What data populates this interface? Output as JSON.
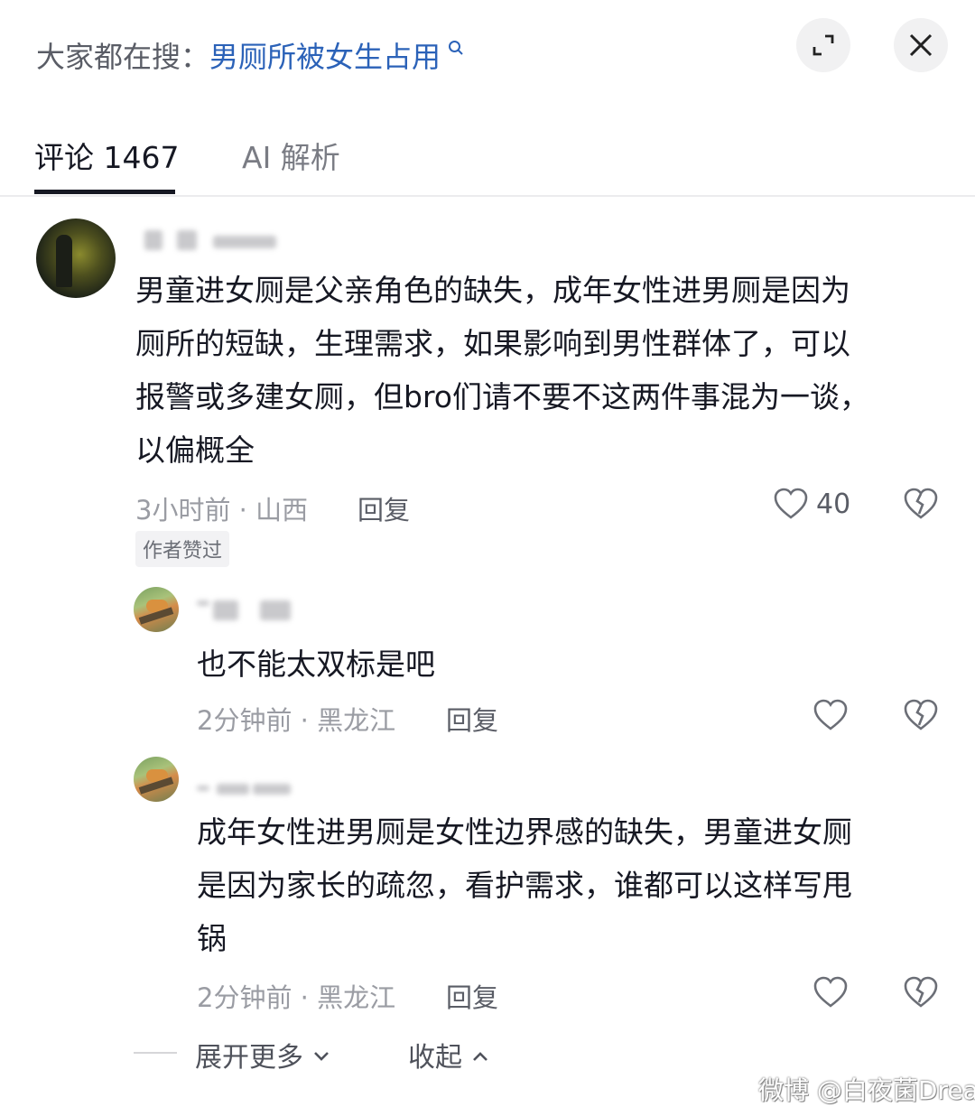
{
  "header": {
    "search_prefix": "大家都在搜：",
    "search_keyword": "男厕所被女生占用"
  },
  "tabs": [
    {
      "label": "评论 1467"
    },
    {
      "label": "AI 解析"
    }
  ],
  "comments": [
    {
      "text_lines": [
        "男童进女厕是父亲角色的缺失，成年女性进男厕是因为",
        "厕所的短缺，生理需求，如果影响到男性群体了，可以",
        "报警或多建女厕，但bro们请不要不这两件事混为一谈，",
        "以偏概全"
      ],
      "meta": "3小时前 · 山西",
      "reply_label": "回复",
      "likes": "40",
      "badge": "作者赞过"
    }
  ],
  "replies": [
    {
      "text_lines": [
        "也不能太双标是吧"
      ],
      "meta": "2分钟前 · 黑龙江",
      "reply_label": "回复"
    },
    {
      "text_lines": [
        "成年女性进男厕是女性边界感的缺失，男童进女厕",
        "是因为家长的疏忽，看护需求，谁都可以这样写甩",
        "锅"
      ],
      "meta": "2分钟前 · 黑龙江",
      "reply_label": "回复"
    }
  ],
  "footer": {
    "expand_more": "展开更多",
    "collapse": "收起"
  },
  "watermark": "微博 @白夜菌Dream",
  "colors": {
    "link": "#2b62b8",
    "text": "#161823",
    "meta": "#9a9ca3"
  }
}
